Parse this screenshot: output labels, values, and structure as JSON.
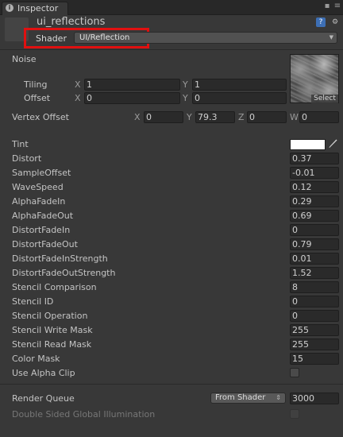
{
  "tab": {
    "label": "Inspector",
    "icon": "info-icon"
  },
  "object": {
    "name": "ui_reflections"
  },
  "shader": {
    "label": "Shader",
    "value": "UI/Reflection",
    "highlight_color": "#e01010"
  },
  "noise": {
    "label": "Noise",
    "tiling_label": "Tiling",
    "offset_label": "Offset",
    "tiling": {
      "x": "1",
      "y": "1"
    },
    "offset": {
      "x": "0",
      "y": "0"
    },
    "select_label": "Select"
  },
  "axes": {
    "x": "X",
    "y": "Y",
    "z": "Z",
    "w": "W"
  },
  "vertex_offset": {
    "label": "Vertex Offset",
    "x": "0",
    "y": "79.3",
    "z": "0",
    "w": "0"
  },
  "tint": {
    "label": "Tint",
    "color": "#ffffff"
  },
  "properties": [
    {
      "label": "Distort",
      "value": "0.37"
    },
    {
      "label": "SampleOffset",
      "value": "-0.01"
    },
    {
      "label": "WaveSpeed",
      "value": "0.12"
    },
    {
      "label": "AlphaFadeIn",
      "value": "0.29"
    },
    {
      "label": "AlphaFadeOut",
      "value": "0.69"
    },
    {
      "label": "DistortFadeIn",
      "value": "0"
    },
    {
      "label": "DistortFadeOut",
      "value": "0.79"
    },
    {
      "label": "DistortFadeInStrength",
      "value": "0.01"
    },
    {
      "label": "DistortFadeOutStrength",
      "value": "1.52"
    },
    {
      "label": "Stencil Comparison",
      "value": "8"
    },
    {
      "label": "Stencil ID",
      "value": "0"
    },
    {
      "label": "Stencil Operation",
      "value": "0"
    },
    {
      "label": "Stencil Write Mask",
      "value": "255"
    },
    {
      "label": "Stencil Read Mask",
      "value": "255"
    },
    {
      "label": "Color Mask",
      "value": "15"
    }
  ],
  "use_alpha_clip": {
    "label": "Use Alpha Clip",
    "checked": false
  },
  "render_queue": {
    "label": "Render Queue",
    "mode": "From Shader",
    "value": "3000"
  },
  "double_sided_gi": {
    "label": "Double Sided Global Illumination",
    "checked": false
  }
}
